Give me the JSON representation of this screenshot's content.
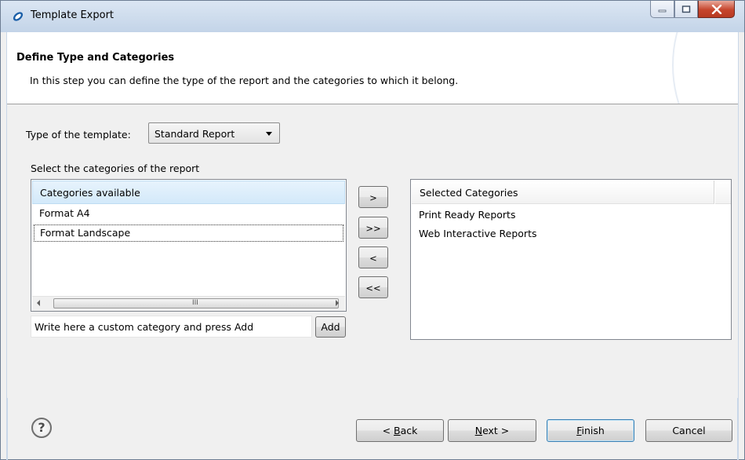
{
  "window": {
    "title": "Template Export",
    "controls": [
      "minimize-icon",
      "maximize-icon",
      "close-icon"
    ]
  },
  "header": {
    "title": "Define Type and Categories",
    "description": "In this step you can define the type of the report and the categories to which it belong."
  },
  "type_field": {
    "label": "Type of the template:",
    "selected": "Standard Report"
  },
  "categories": {
    "label": "Select the categories of the report",
    "available_header": "Categories available",
    "available": [
      "Format A4",
      "Format Landscape"
    ],
    "selected_header": "Selected Categories",
    "selected": [
      "Print Ready Reports",
      "Web Interactive Reports"
    ],
    "custom_placeholder": "Write here a custom category and press Add",
    "add_label": "Add"
  },
  "move_buttons": {
    "add_one": ">",
    "add_all": ">>",
    "remove_one": "<",
    "remove_all": "<<"
  },
  "scrollbar": {
    "grip": "III"
  },
  "footer": {
    "help_icon": "?",
    "back": "< Back",
    "back_mnemonic": "B",
    "next": "Next >",
    "next_mnemonic": "N",
    "finish": "Finish",
    "finish_mnemonic": "F",
    "cancel": "Cancel"
  },
  "colors": {
    "titlebar": "#c3d4e8",
    "selection_header": "#d3e9fa",
    "close_button": "#c6452c"
  }
}
